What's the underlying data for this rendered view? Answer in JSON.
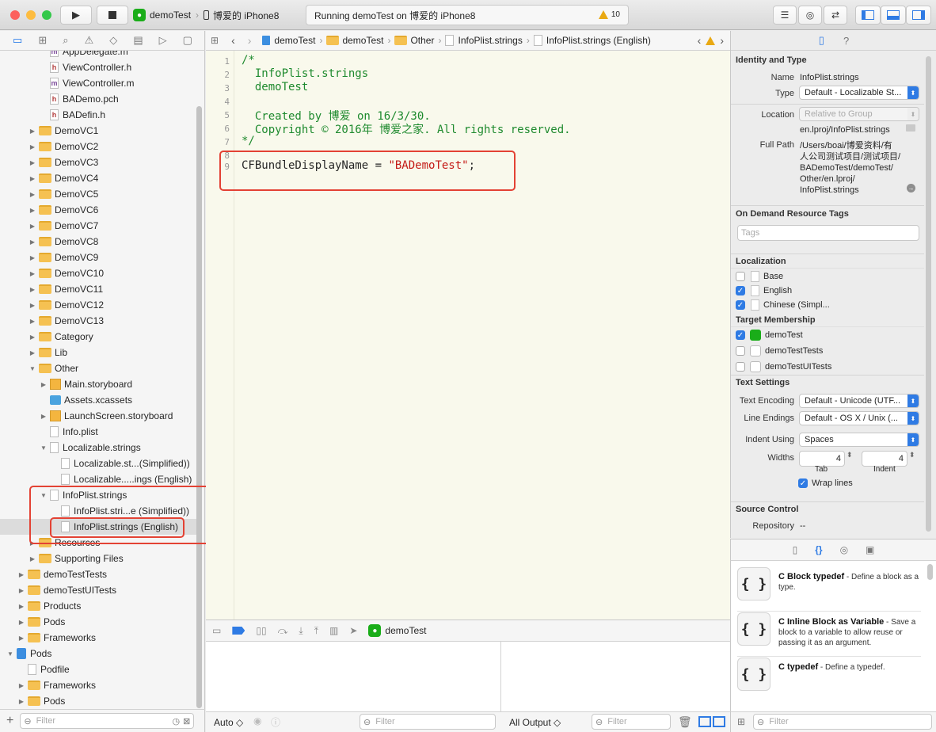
{
  "toolbar": {
    "scheme_target": "demoTest",
    "scheme_device": "博爱的 iPhone8",
    "activity_text": "Running demoTest on 博爱的 iPhone8",
    "warning_count": "10"
  },
  "navigator": {
    "items": [
      {
        "label": "AppDelegate.m",
        "depth": 3,
        "kind": "m"
      },
      {
        "label": "ViewController.h",
        "depth": 3,
        "kind": "h"
      },
      {
        "label": "ViewController.m",
        "depth": 3,
        "kind": "m"
      },
      {
        "label": "BADemo.pch",
        "depth": 3,
        "kind": "h"
      },
      {
        "label": "BADefin.h",
        "depth": 3,
        "kind": "h"
      },
      {
        "label": "DemoVC1",
        "depth": 2,
        "kind": "folder"
      },
      {
        "label": "DemoVC2",
        "depth": 2,
        "kind": "folder"
      },
      {
        "label": "DemoVC3",
        "depth": 2,
        "kind": "folder"
      },
      {
        "label": "DemoVC4",
        "depth": 2,
        "kind": "folder"
      },
      {
        "label": "DemoVC5",
        "depth": 2,
        "kind": "folder"
      },
      {
        "label": "DemoVC6",
        "depth": 2,
        "kind": "folder"
      },
      {
        "label": "DemoVC7",
        "depth": 2,
        "kind": "folder"
      },
      {
        "label": "DemoVC8",
        "depth": 2,
        "kind": "folder"
      },
      {
        "label": "DemoVC9",
        "depth": 2,
        "kind": "folder"
      },
      {
        "label": "DemoVC10",
        "depth": 2,
        "kind": "folder"
      },
      {
        "label": "DemoVC11",
        "depth": 2,
        "kind": "folder"
      },
      {
        "label": "DemoVC12",
        "depth": 2,
        "kind": "folder"
      },
      {
        "label": "DemoVC13",
        "depth": 2,
        "kind": "folder"
      },
      {
        "label": "Category",
        "depth": 2,
        "kind": "folder"
      },
      {
        "label": "Lib",
        "depth": 2,
        "kind": "folder"
      },
      {
        "label": "Other",
        "depth": 2,
        "kind": "folder-open"
      },
      {
        "label": "Main.storyboard",
        "depth": 3,
        "kind": "storyboard"
      },
      {
        "label": "Assets.xcassets",
        "depth": 3,
        "kind": "xcassets"
      },
      {
        "label": "LaunchScreen.storyboard",
        "depth": 3,
        "kind": "storyboard"
      },
      {
        "label": "Info.plist",
        "depth": 3,
        "kind": "file"
      },
      {
        "label": "Localizable.strings",
        "depth": 3,
        "kind": "group-open"
      },
      {
        "label": "Localizable.st...(Simplified))",
        "depth": 4,
        "kind": "file"
      },
      {
        "label": "Localizable.....ings (English)",
        "depth": 4,
        "kind": "file"
      },
      {
        "label": "InfoPlist.strings",
        "depth": 3,
        "kind": "group-open"
      },
      {
        "label": "InfoPlist.stri...e (Simplified))",
        "depth": 4,
        "kind": "file"
      },
      {
        "label": "InfoPlist.strings (English)",
        "depth": 4,
        "kind": "file",
        "selected": true
      },
      {
        "label": "Resources",
        "depth": 2,
        "kind": "folder"
      },
      {
        "label": "Supporting Files",
        "depth": 2,
        "kind": "folder"
      },
      {
        "label": "demoTestTests",
        "depth": 1,
        "kind": "folder"
      },
      {
        "label": "demoTestUITests",
        "depth": 1,
        "kind": "folder"
      },
      {
        "label": "Products",
        "depth": 1,
        "kind": "folder"
      },
      {
        "label": "Pods",
        "depth": 1,
        "kind": "folder"
      },
      {
        "label": "Frameworks",
        "depth": 1,
        "kind": "folder"
      },
      {
        "label": "Pods",
        "depth": 0,
        "kind": "project"
      },
      {
        "label": "Podfile",
        "depth": 1,
        "kind": "file-leaf"
      },
      {
        "label": "Frameworks",
        "depth": 1,
        "kind": "folder"
      },
      {
        "label": "Pods",
        "depth": 1,
        "kind": "folder"
      }
    ],
    "filter_placeholder": "Filter"
  },
  "jumpbar": {
    "crumbs": [
      "demoTest",
      "demoTest",
      "Other",
      "InfoPlist.strings",
      "InfoPlist.strings (English)"
    ]
  },
  "editor": {
    "lines": [
      {
        "n": "1",
        "text": "/*",
        "cls": "cm"
      },
      {
        "n": "2",
        "text": "  InfoPlist.strings",
        "cls": "cm"
      },
      {
        "n": "3",
        "text": "  demoTest",
        "cls": "cm"
      },
      {
        "n": "4",
        "text": "",
        "cls": "cm"
      },
      {
        "n": "5",
        "text": "  Created by 博爱 on 16/3/30.",
        "cls": "cm"
      },
      {
        "n": "6",
        "text": "  Copyright © 2016年 博爱之家. All rights reserved.",
        "cls": "cm"
      },
      {
        "n": "7",
        "text": "*/",
        "cls": "cm"
      },
      {
        "n": "8",
        "text": "",
        "cls": ""
      },
      {
        "n": "9",
        "key": "CFBundleDisplayName = ",
        "value": "\"BADemoTest\"",
        "tail": ";"
      }
    ]
  },
  "debug": {
    "target": "demoTest",
    "auto_label": "Auto ◇",
    "filter_placeholder": "Filter",
    "output_label": "All Output ◇"
  },
  "inspector": {
    "identity_title": "Identity and Type",
    "name_label": "Name",
    "name_value": "InfoPlist.strings",
    "type_label": "Type",
    "type_value": "Default - Localizable St...",
    "location_label": "Location",
    "location_value": "Relative to Group",
    "location_path": "en.lproj/InfoPlist.strings",
    "fullpath_label": "Full Path",
    "fullpath_lines": [
      "/Users/boai/博爱资料/有",
      "人公司测试项目/测试项目/",
      "BADemoTest/demoTest/",
      "Other/en.lproj/",
      "InfoPlist.strings"
    ],
    "ondemand_title": "On Demand Resource Tags",
    "tags_placeholder": "Tags",
    "localization_title": "Localization",
    "localizations": [
      {
        "label": "Base",
        "checked": false
      },
      {
        "label": "English",
        "checked": true
      },
      {
        "label": "Chinese (Simpl...",
        "checked": true
      }
    ],
    "membership_title": "Target Membership",
    "targets": [
      {
        "label": "demoTest",
        "checked": true
      },
      {
        "label": "demoTestTests",
        "checked": false
      },
      {
        "label": "demoTestUITests",
        "checked": false
      }
    ],
    "text_settings_title": "Text Settings",
    "encoding_label": "Text Encoding",
    "encoding_value": "Default - Unicode (UTF...",
    "endings_label": "Line Endings",
    "endings_value": "Default - OS X / Unix (...",
    "indent_label": "Indent Using",
    "indent_value": "Spaces",
    "widths_label": "Widths",
    "tab_value": "4",
    "indent_width_value": "4",
    "tab_caption": "Tab",
    "indent_caption": "Indent",
    "wrap_label": "Wrap lines",
    "source_control_title": "Source Control",
    "repository_label": "Repository",
    "repository_value": "--"
  },
  "library": {
    "items": [
      {
        "title": "C Block typedef",
        "desc": " - Define a block as a type."
      },
      {
        "title": "C Inline Block as Variable",
        "desc": " - Save a block to a variable to allow reuse or passing it as an argument."
      },
      {
        "title": "C typedef",
        "desc": " - Define a typedef."
      }
    ],
    "filter_placeholder": "Filter"
  },
  "colors": {
    "accent": "#2f7be4",
    "annotation_red": "#e34234",
    "comment_green": "#1e8a2e",
    "string_red": "#c41a16"
  }
}
